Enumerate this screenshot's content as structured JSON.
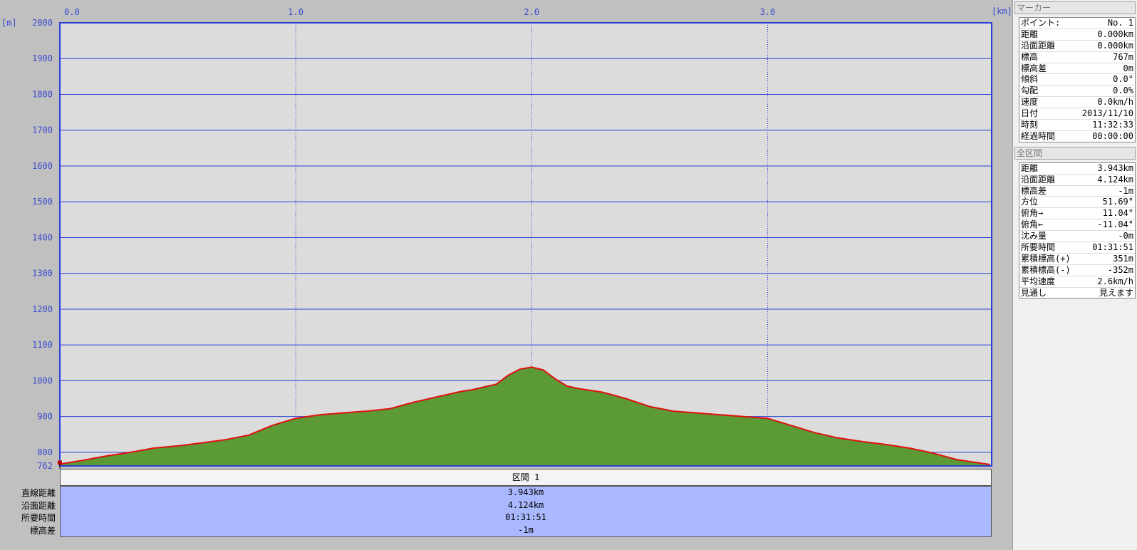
{
  "chart_data": {
    "type": "area",
    "xlabel": "[km]",
    "ylabel": "[m]",
    "xlim": [
      0,
      3.95
    ],
    "ylim": [
      762,
      2000
    ],
    "x_ticks": [
      "0.0",
      "1.0",
      "2.0",
      "3.0"
    ],
    "y_ticks": [
      "2000",
      "1900",
      "1800",
      "1700",
      "1600",
      "1500",
      "1400",
      "1300",
      "1200",
      "1100",
      "1000",
      "900",
      "800"
    ],
    "y_min_label": "762",
    "series": [
      {
        "x": [
          0,
          0.1,
          0.2,
          0.3,
          0.4,
          0.5,
          0.6,
          0.7,
          0.8,
          0.9,
          1.0,
          1.1,
          1.2,
          1.3,
          1.4,
          1.5,
          1.6,
          1.7,
          1.75,
          1.8,
          1.85,
          1.9,
          1.95,
          2.0,
          2.05,
          2.1,
          2.15,
          2.2,
          2.3,
          2.4,
          2.5,
          2.6,
          2.7,
          2.8,
          2.9,
          3.0,
          3.1,
          3.2,
          3.3,
          3.4,
          3.5,
          3.6,
          3.7,
          3.8,
          3.9,
          3.943
        ],
        "y": [
          767,
          778,
          790,
          800,
          812,
          818,
          826,
          835,
          848,
          875,
          895,
          905,
          910,
          915,
          922,
          940,
          955,
          970,
          975,
          983,
          990,
          1015,
          1032,
          1038,
          1030,
          1005,
          985,
          978,
          968,
          950,
          928,
          915,
          910,
          905,
          900,
          895,
          875,
          855,
          840,
          830,
          822,
          812,
          798,
          780,
          770,
          766
        ]
      }
    ]
  },
  "segment": {
    "header": "区間 1",
    "labels": [
      "直線距離",
      "沿面距離",
      "所要時間",
      "標高差"
    ],
    "values": [
      "3.943km",
      "4.124km",
      "01:31:51",
      "-1m"
    ]
  },
  "marker_panel": {
    "title": "マーカー",
    "rows": [
      {
        "label": "ポイント:",
        "value": "No. 1"
      },
      {
        "label": "距離",
        "value": "0.000km"
      },
      {
        "label": "沿面距離",
        "value": "0.000km"
      },
      {
        "label": "標高",
        "value": "767m"
      },
      {
        "label": "標高差",
        "value": "0m"
      },
      {
        "label": "傾斜",
        "value": "0.0°"
      },
      {
        "label": "勾配",
        "value": "0.0%"
      },
      {
        "label": "速度",
        "value": "0.0km/h"
      },
      {
        "label": "日付",
        "value": "2013/11/10"
      },
      {
        "label": "時刻",
        "value": "11:32:33"
      },
      {
        "label": "経過時間",
        "value": "00:00:00"
      }
    ]
  },
  "total_panel": {
    "title": "全区間",
    "rows": [
      {
        "label": "距離",
        "value": "3.943km"
      },
      {
        "label": "沿面距離",
        "value": "4.124km"
      },
      {
        "label": "標高差",
        "value": "-1m"
      },
      {
        "label": "方位",
        "value": "51.69°"
      },
      {
        "label": "俯角→",
        "value": "11.04°"
      },
      {
        "label": "俯角←",
        "value": "-11.04°"
      },
      {
        "label": "沈み量",
        "value": "-0m"
      },
      {
        "label": "所要時間",
        "value": "01:31:51"
      },
      {
        "label": "累積標高(+)",
        "value": "351m"
      },
      {
        "label": "累積標高(-)",
        "value": "-352m"
      },
      {
        "label": "平均速度",
        "value": "2.6km/h"
      },
      {
        "label": "見通し",
        "value": "見えます"
      }
    ]
  },
  "colors": {
    "fill": "#5b9a35",
    "line": "#e01010",
    "grid": "#2b3fd6",
    "plot_bg": "#dcdcdc"
  }
}
